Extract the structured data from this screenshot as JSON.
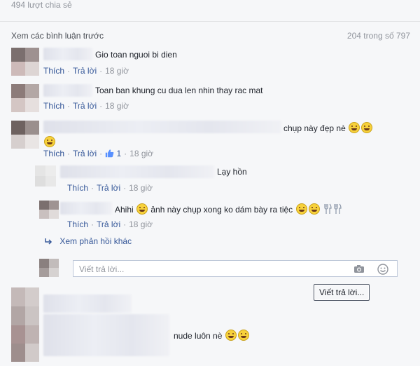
{
  "header": {
    "share_count": "494 lượt chia sẻ",
    "prev_comments": "Xem các bình luận trước",
    "counter": "204 trong số 797"
  },
  "actions": {
    "like": "Thích",
    "reply": "Trả lời"
  },
  "comments": [
    {
      "text": "Gio toan nguoi bi dien",
      "time": "18 giờ"
    },
    {
      "text": "Toan ban khung cu dua len nhin thay rac mat",
      "time": "18 giờ"
    },
    {
      "text": "chụp này đẹp nè",
      "time": "18 giờ",
      "like_count": "1"
    },
    {
      "text": "nude luôn nè"
    }
  ],
  "replies": [
    {
      "text": "Lạy hồn",
      "time": "18 giờ"
    },
    {
      "text_a": "Ahihi",
      "text_b": "ảnh này chụp xong ko dám bày ra tiệc",
      "time": "18 giờ"
    }
  ],
  "more_replies": "Xem phản hồi khác",
  "reply_box": {
    "placeholder": "Viết trả lời..."
  },
  "write_reply_button": "Viết trả lời..."
}
